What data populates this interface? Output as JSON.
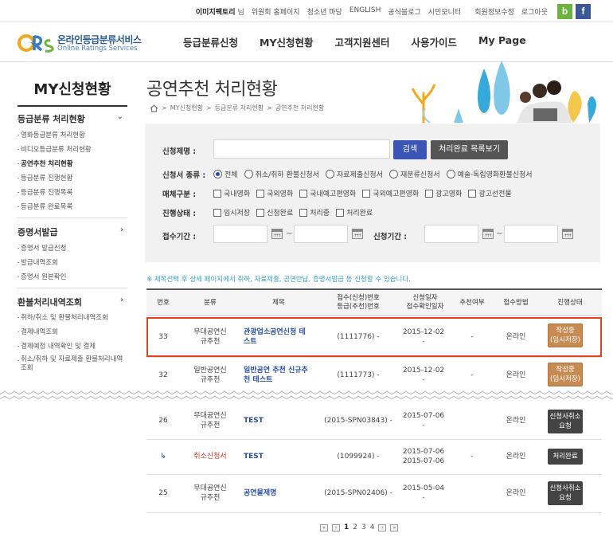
{
  "topbar": {
    "user_name": "이미지팩토리",
    "user_suffix": "님",
    "links": [
      "위원회 홈페이지",
      "청소년 마당",
      "ENGLISH",
      "공식블로그",
      "시민모니터"
    ],
    "member_edit": "회원정보수정",
    "logout": "로그아웃",
    "blog_icon": "b",
    "facebook_icon": "f"
  },
  "logo": {
    "title": "온라인등급분류서비스",
    "subtitle": "Online Ratings Services"
  },
  "gnb": [
    "등급분류신청",
    "MY신청현황",
    "고객지원센터",
    "사용가이드",
    "My Page"
  ],
  "sidebar": {
    "title": "MY신청현황",
    "groups": [
      {
        "label": "등급분류 처리현황",
        "arrow": "⌄",
        "items": [
          "영화등급분류 처리현황",
          "비디오등급분류 처리현황",
          "공연추천 처리현황",
          "등급분류 진행현황",
          "등급분류 진행목록",
          "등급분류 완료목록"
        ]
      },
      {
        "label": "증명서발급",
        "arrow": "›",
        "items": [
          "증명서 발급신청",
          "발급내역조회",
          "증명서 원본확인"
        ]
      },
      {
        "label": "환불처리내역조회",
        "arrow": "›",
        "items": [
          "취하/취소 및 환불처리내역조회",
          "결제내역조회",
          "결제예정 내역확인 및 결제",
          "취소/취하 및 자료제출 환불처리내역조회"
        ]
      }
    ]
  },
  "page": {
    "title": "공연추천 처리현황",
    "breadcrumb": [
      "MY신청현황",
      "등급분류 처리현황",
      "공연추천 처리현황"
    ]
  },
  "search": {
    "title_label": "신청제명 :",
    "title_value": "",
    "search_button": "검색",
    "complete_button": "처리완료 목록보기",
    "type_label": "신청서 종류 :",
    "type_options": [
      "전체",
      "취소/취하 환불신청서",
      "자료제출신청서",
      "재분류신청서",
      "예술·독립영화환불신청서"
    ],
    "type_selected": "전체",
    "media_label": "매체구분 :",
    "media_options": [
      "국내영화",
      "국외영화",
      "국내예고편영화",
      "국외예고편영화",
      "광고영화",
      "광고선전물"
    ],
    "state_label": "진행상태 :",
    "state_options": [
      "임시저장",
      "신청완료",
      "처리중",
      "처리완료"
    ],
    "receipt_label": "접수기간 :",
    "apply_label": "신청기간 :",
    "tilde": "~"
  },
  "notice": "※ 제목선택 후 상세 페이지에서 취하, 자료제출, 공연반납, 증명서발급 등 신청할 수 있습니다.",
  "table": {
    "headers": [
      "번호",
      "분류",
      "제목",
      "접수(신청)번호\n등급(추천)번호",
      "신청일자\n접수확인일자",
      "추천여부",
      "접수방법",
      "진행상태"
    ],
    "rows": [
      {
        "no": "33",
        "category": "무대공연신\n규추천",
        "title": "관광업소공연신청 테\n스트",
        "number": "(1111776) -",
        "dates": "2015-12-02\n-",
        "rec": "-",
        "method": "온라인",
        "status": "작성중\n(임시저장)"
      },
      {
        "no": "32",
        "category": "일반공연신\n규추천",
        "title": "일반공연 추천 신규추\n천 테스트",
        "number": "(1111773) -",
        "dates": "2015-12-02\n-",
        "rec": "-",
        "method": "온라인",
        "status": "작성중\n(임시저장)"
      },
      {
        "no": "26",
        "category": "무대공연신\n규추천",
        "title": "TEST",
        "number": "(2015-SPN03843) -",
        "dates": "2015-07-06\n-",
        "rec": "",
        "method": "온라인",
        "status": "신청사취소\n요청"
      },
      {
        "no": "↳",
        "category": "취소신청서",
        "title": "TEST",
        "number": "(1099924) -",
        "dates": "2015-07-06\n2015-07-06",
        "rec": "-",
        "method": "온라인",
        "status": "처리완료"
      },
      {
        "no": "25",
        "category": "무대공연신\n규추천",
        "title": "공연물제명",
        "number": "(2015-SPN02406) -",
        "dates": "2015-05-04\n-",
        "rec": "",
        "method": "온라인",
        "status": "신청사취소\n요청"
      }
    ]
  },
  "pager": {
    "first": "«",
    "prev": "‹",
    "pages": [
      "1",
      "2",
      "3",
      "4"
    ],
    "current": "1",
    "next": "›",
    "last": "»"
  },
  "colors": {
    "accent": "#3a55b6",
    "highlight": "#e0441f",
    "notice": "#3aa0c8",
    "status_orange": "#c68a53",
    "status_dark": "#444444"
  }
}
